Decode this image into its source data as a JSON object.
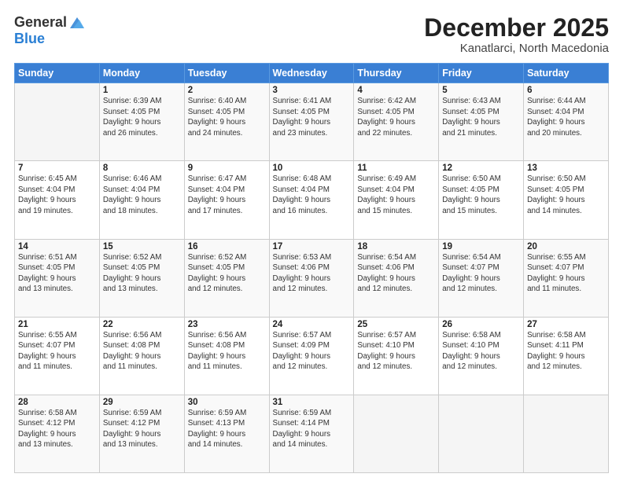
{
  "logo": {
    "general": "General",
    "blue": "Blue"
  },
  "header": {
    "month": "December 2025",
    "location": "Kanatlarci, North Macedonia"
  },
  "days_of_week": [
    "Sunday",
    "Monday",
    "Tuesday",
    "Wednesday",
    "Thursday",
    "Friday",
    "Saturday"
  ],
  "weeks": [
    [
      {
        "day": "",
        "info": ""
      },
      {
        "day": "1",
        "info": "Sunrise: 6:39 AM\nSunset: 4:05 PM\nDaylight: 9 hours\nand 26 minutes."
      },
      {
        "day": "2",
        "info": "Sunrise: 6:40 AM\nSunset: 4:05 PM\nDaylight: 9 hours\nand 24 minutes."
      },
      {
        "day": "3",
        "info": "Sunrise: 6:41 AM\nSunset: 4:05 PM\nDaylight: 9 hours\nand 23 minutes."
      },
      {
        "day": "4",
        "info": "Sunrise: 6:42 AM\nSunset: 4:05 PM\nDaylight: 9 hours\nand 22 minutes."
      },
      {
        "day": "5",
        "info": "Sunrise: 6:43 AM\nSunset: 4:05 PM\nDaylight: 9 hours\nand 21 minutes."
      },
      {
        "day": "6",
        "info": "Sunrise: 6:44 AM\nSunset: 4:04 PM\nDaylight: 9 hours\nand 20 minutes."
      }
    ],
    [
      {
        "day": "7",
        "info": "Sunrise: 6:45 AM\nSunset: 4:04 PM\nDaylight: 9 hours\nand 19 minutes."
      },
      {
        "day": "8",
        "info": "Sunrise: 6:46 AM\nSunset: 4:04 PM\nDaylight: 9 hours\nand 18 minutes."
      },
      {
        "day": "9",
        "info": "Sunrise: 6:47 AM\nSunset: 4:04 PM\nDaylight: 9 hours\nand 17 minutes."
      },
      {
        "day": "10",
        "info": "Sunrise: 6:48 AM\nSunset: 4:04 PM\nDaylight: 9 hours\nand 16 minutes."
      },
      {
        "day": "11",
        "info": "Sunrise: 6:49 AM\nSunset: 4:04 PM\nDaylight: 9 hours\nand 15 minutes."
      },
      {
        "day": "12",
        "info": "Sunrise: 6:50 AM\nSunset: 4:05 PM\nDaylight: 9 hours\nand 15 minutes."
      },
      {
        "day": "13",
        "info": "Sunrise: 6:50 AM\nSunset: 4:05 PM\nDaylight: 9 hours\nand 14 minutes."
      }
    ],
    [
      {
        "day": "14",
        "info": "Sunrise: 6:51 AM\nSunset: 4:05 PM\nDaylight: 9 hours\nand 13 minutes."
      },
      {
        "day": "15",
        "info": "Sunrise: 6:52 AM\nSunset: 4:05 PM\nDaylight: 9 hours\nand 13 minutes."
      },
      {
        "day": "16",
        "info": "Sunrise: 6:52 AM\nSunset: 4:05 PM\nDaylight: 9 hours\nand 12 minutes."
      },
      {
        "day": "17",
        "info": "Sunrise: 6:53 AM\nSunset: 4:06 PM\nDaylight: 9 hours\nand 12 minutes."
      },
      {
        "day": "18",
        "info": "Sunrise: 6:54 AM\nSunset: 4:06 PM\nDaylight: 9 hours\nand 12 minutes."
      },
      {
        "day": "19",
        "info": "Sunrise: 6:54 AM\nSunset: 4:07 PM\nDaylight: 9 hours\nand 12 minutes."
      },
      {
        "day": "20",
        "info": "Sunrise: 6:55 AM\nSunset: 4:07 PM\nDaylight: 9 hours\nand 11 minutes."
      }
    ],
    [
      {
        "day": "21",
        "info": "Sunrise: 6:55 AM\nSunset: 4:07 PM\nDaylight: 9 hours\nand 11 minutes."
      },
      {
        "day": "22",
        "info": "Sunrise: 6:56 AM\nSunset: 4:08 PM\nDaylight: 9 hours\nand 11 minutes."
      },
      {
        "day": "23",
        "info": "Sunrise: 6:56 AM\nSunset: 4:08 PM\nDaylight: 9 hours\nand 11 minutes."
      },
      {
        "day": "24",
        "info": "Sunrise: 6:57 AM\nSunset: 4:09 PM\nDaylight: 9 hours\nand 12 minutes."
      },
      {
        "day": "25",
        "info": "Sunrise: 6:57 AM\nSunset: 4:10 PM\nDaylight: 9 hours\nand 12 minutes."
      },
      {
        "day": "26",
        "info": "Sunrise: 6:58 AM\nSunset: 4:10 PM\nDaylight: 9 hours\nand 12 minutes."
      },
      {
        "day": "27",
        "info": "Sunrise: 6:58 AM\nSunset: 4:11 PM\nDaylight: 9 hours\nand 12 minutes."
      }
    ],
    [
      {
        "day": "28",
        "info": "Sunrise: 6:58 AM\nSunset: 4:12 PM\nDaylight: 9 hours\nand 13 minutes."
      },
      {
        "day": "29",
        "info": "Sunrise: 6:59 AM\nSunset: 4:12 PM\nDaylight: 9 hours\nand 13 minutes."
      },
      {
        "day": "30",
        "info": "Sunrise: 6:59 AM\nSunset: 4:13 PM\nDaylight: 9 hours\nand 14 minutes."
      },
      {
        "day": "31",
        "info": "Sunrise: 6:59 AM\nSunset: 4:14 PM\nDaylight: 9 hours\nand 14 minutes."
      },
      {
        "day": "",
        "info": ""
      },
      {
        "day": "",
        "info": ""
      },
      {
        "day": "",
        "info": ""
      }
    ]
  ]
}
